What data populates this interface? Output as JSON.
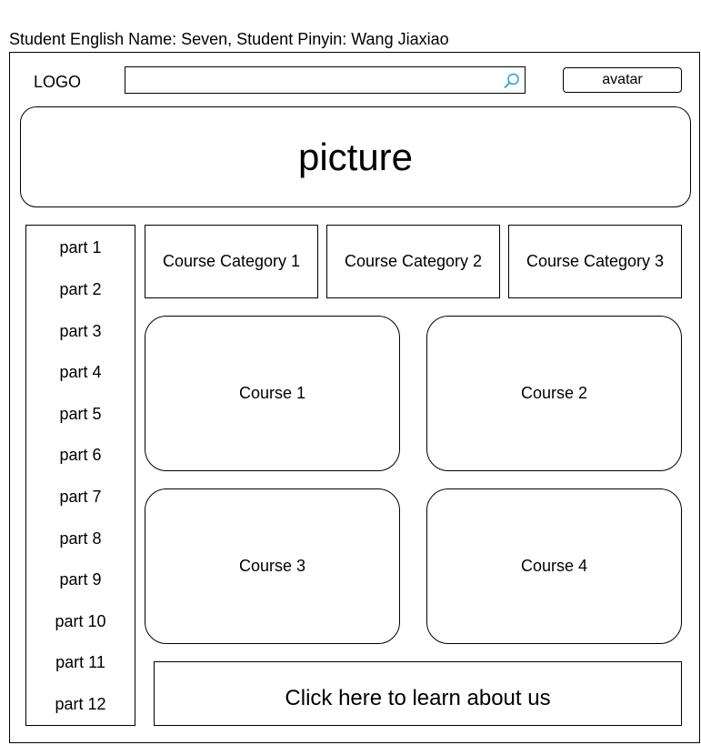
{
  "header": {
    "student_line": "Student English Name: Seven, Student Pinyin: Wang Jiaxiao",
    "logo": "LOGO",
    "search": {
      "value": "",
      "icon": "search-icon"
    },
    "avatar_label": "avatar"
  },
  "banner": {
    "label": "picture"
  },
  "sidebar": {
    "items": [
      {
        "label": "part 1"
      },
      {
        "label": "part 2"
      },
      {
        "label": "part 3"
      },
      {
        "label": "part 4"
      },
      {
        "label": "part 5"
      },
      {
        "label": "part 6"
      },
      {
        "label": "part 7"
      },
      {
        "label": "part 8"
      },
      {
        "label": "part 9"
      },
      {
        "label": "part 10"
      },
      {
        "label": "part 11"
      },
      {
        "label": "part 12"
      }
    ]
  },
  "categories": [
    {
      "label": "Course Category 1"
    },
    {
      "label": "Course Category 2"
    },
    {
      "label": "Course Category 3"
    }
  ],
  "courses": [
    {
      "label": "Course 1"
    },
    {
      "label": "Course 2"
    },
    {
      "label": "Course 3"
    },
    {
      "label": "Course 4"
    }
  ],
  "footer": {
    "about_label": "Click here to learn about us"
  },
  "colors": {
    "search_icon": "#1e9bd7",
    "stroke": "#000000"
  }
}
